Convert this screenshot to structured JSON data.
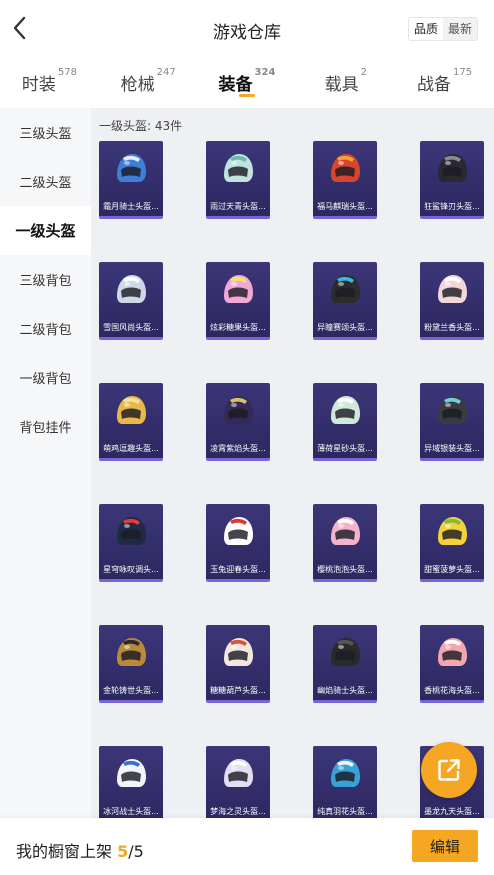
{
  "header": {
    "title": "游戏仓库",
    "sort_options": [
      "品质",
      "最新"
    ],
    "active_sort": "品质"
  },
  "tabs": [
    {
      "label": "时装",
      "count": "578",
      "active": false
    },
    {
      "label": "枪械",
      "count": "247",
      "active": false
    },
    {
      "label": "装备",
      "count": "324",
      "active": true
    },
    {
      "label": "载具",
      "count": "2",
      "active": false
    },
    {
      "label": "战备",
      "count": "175",
      "active": false
    }
  ],
  "sidebar": {
    "items": [
      {
        "label": "三级头盔",
        "active": false
      },
      {
        "label": "二级头盔",
        "active": false
      },
      {
        "label": "一级头盔",
        "active": true
      },
      {
        "label": "三级背包",
        "active": false
      },
      {
        "label": "二级背包",
        "active": false
      },
      {
        "label": "一级背包",
        "active": false
      },
      {
        "label": "背包挂件",
        "active": false
      }
    ]
  },
  "content": {
    "count_label": "一级头盔: 43件",
    "items": [
      {
        "name": "霜月骑士头盔...",
        "color": "#3f7fd9",
        "accent": "#e8ecf5"
      },
      {
        "name": "雨过天青头盔...",
        "color": "#bfe3de",
        "accent": "#6fb7b1"
      },
      {
        "name": "福马麒瑞头盔...",
        "color": "#d8452e",
        "accent": "#f2a33a"
      },
      {
        "name": "狂鲨锋刃头盔...",
        "color": "#2a2a2e",
        "accent": "#8a8a90"
      },
      {
        "name": "雪国风尚头盔...",
        "color": "#cfd8e6",
        "accent": "#ffffff"
      },
      {
        "name": "炫彩糖果头盔...",
        "color": "#f2a8d6",
        "accent": "#f6e36a"
      },
      {
        "name": "异瞳赛颂头盔...",
        "color": "#2c2c2c",
        "accent": "#36b9e8"
      },
      {
        "name": "粉黛兰香头盔...",
        "color": "#f3d6dc",
        "accent": "#ffffff"
      },
      {
        "name": "萌鸡逗趣头盔...",
        "color": "#e9b84a",
        "accent": "#f6e0a0"
      },
      {
        "name": "凌霄紫焰头盔...",
        "color": "#332b55",
        "accent": "#d6c26a"
      },
      {
        "name": "薄荷星砂头盔...",
        "color": "#cfe8d8",
        "accent": "#ffffff"
      },
      {
        "name": "异域银装头盔...",
        "color": "#3a3a40",
        "accent": "#6ed0d8"
      },
      {
        "name": "星穹咏叹调头...",
        "color": "#1f2a44",
        "accent": "#e83a3a"
      },
      {
        "name": "玉兔迎春头盔...",
        "color": "#ffffff",
        "accent": "#d9383a"
      },
      {
        "name": "樱桃泡泡头盔...",
        "color": "#f3b3cc",
        "accent": "#ffffff"
      },
      {
        "name": "甜蜜菠萝头盔...",
        "color": "#f2d23a",
        "accent": "#7bbf3a"
      },
      {
        "name": "金轮铸世头盔...",
        "color": "#b98a3a",
        "accent": "#2a2a2a"
      },
      {
        "name": "糖糖葫芦头盔...",
        "color": "#f3e6dc",
        "accent": "#d9533a"
      },
      {
        "name": "幽焰骑士头盔...",
        "color": "#2a2a2a",
        "accent": "#555555"
      },
      {
        "name": "香桃花海头盔...",
        "color": "#f1a6b0",
        "accent": "#ffffff"
      },
      {
        "name": "冰河战士头盔...",
        "color": "#f2f4f8",
        "accent": "#3a6fd0"
      },
      {
        "name": "梦海之灵头盔...",
        "color": "#e3def2",
        "accent": "#ffffff"
      },
      {
        "name": "纯真羽花头盔...",
        "color": "#3aa0d8",
        "accent": "#f2f2f2"
      },
      {
        "name": "墨龙九天头盔...",
        "color": "#2a2a2a",
        "accent": "#d6b04a"
      }
    ]
  },
  "fab": {
    "icon": "share-external-icon"
  },
  "bottom": {
    "label_prefix": "我的橱窗上架",
    "current": "5",
    "total": "/5",
    "edit_label": "编辑"
  }
}
